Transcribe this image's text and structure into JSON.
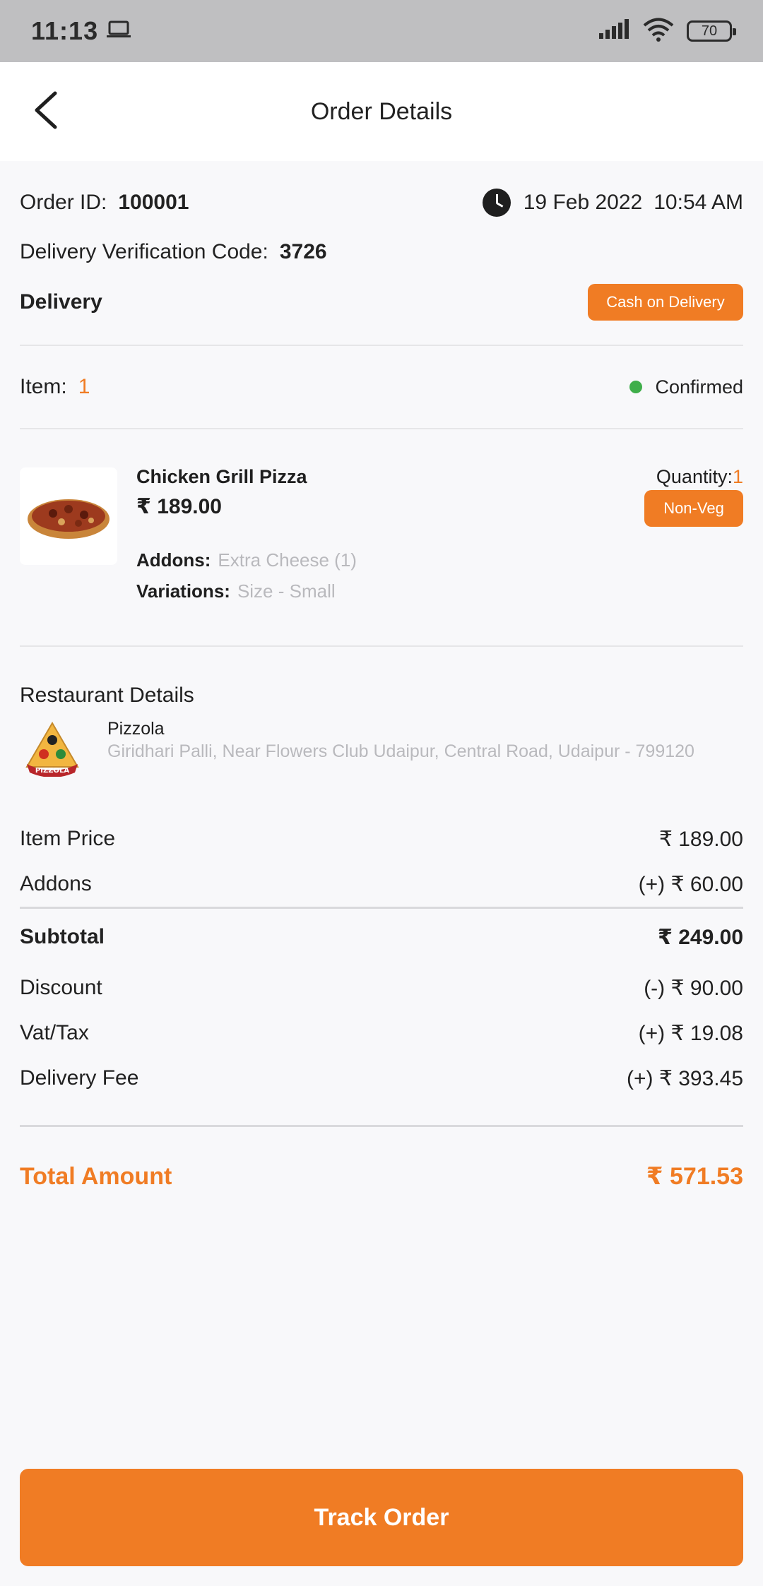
{
  "status_bar": {
    "time": "11:13",
    "battery": "70"
  },
  "app_bar": {
    "title": "Order Details"
  },
  "order": {
    "id_label": "Order ID:",
    "id_value": "100001",
    "date": "19 Feb 2022",
    "time": "10:54 AM",
    "verification_label": "Delivery Verification Code:",
    "verification_value": "3726",
    "delivery_label": "Delivery",
    "payment_badge": "Cash on Delivery"
  },
  "items_summary": {
    "label": "Item:",
    "count": "1",
    "status": "Confirmed",
    "status_color": "#3fae4a"
  },
  "item": {
    "name": "Chicken Grill Pizza",
    "price": "₹ 189.00",
    "quantity_label": "Quantity:",
    "quantity_value": "1",
    "type_badge": "Non-Veg",
    "addons_label": "Addons:",
    "addons_value": "Extra Cheese (1)",
    "variations_label": "Variations:",
    "variations_value": "Size - Small"
  },
  "restaurant": {
    "section_title": "Restaurant Details",
    "logo_text": "PIZZOLA",
    "name": "Pizzola",
    "address": "Giridhari Palli, Near Flowers Club Udaipur, Central Road, Udaipur - 799120"
  },
  "pricing": {
    "item_price_label": "Item Price",
    "item_price_value": "₹ 189.00",
    "addons_label": "Addons",
    "addons_value": "(+) ₹ 60.00",
    "subtotal_label": "Subtotal",
    "subtotal_value": "₹ 249.00",
    "discount_label": "Discount",
    "discount_value": "(-) ₹ 90.00",
    "tax_label": "Vat/Tax",
    "tax_value": "(+) ₹ 19.08",
    "delivery_fee_label": "Delivery Fee",
    "delivery_fee_value": "(+) ₹ 393.45",
    "total_label": "Total Amount",
    "total_value": "₹ 571.53"
  },
  "actions": {
    "track_order": "Track Order"
  },
  "colors": {
    "accent": "#f07c24",
    "status_green": "#3fae4a"
  }
}
